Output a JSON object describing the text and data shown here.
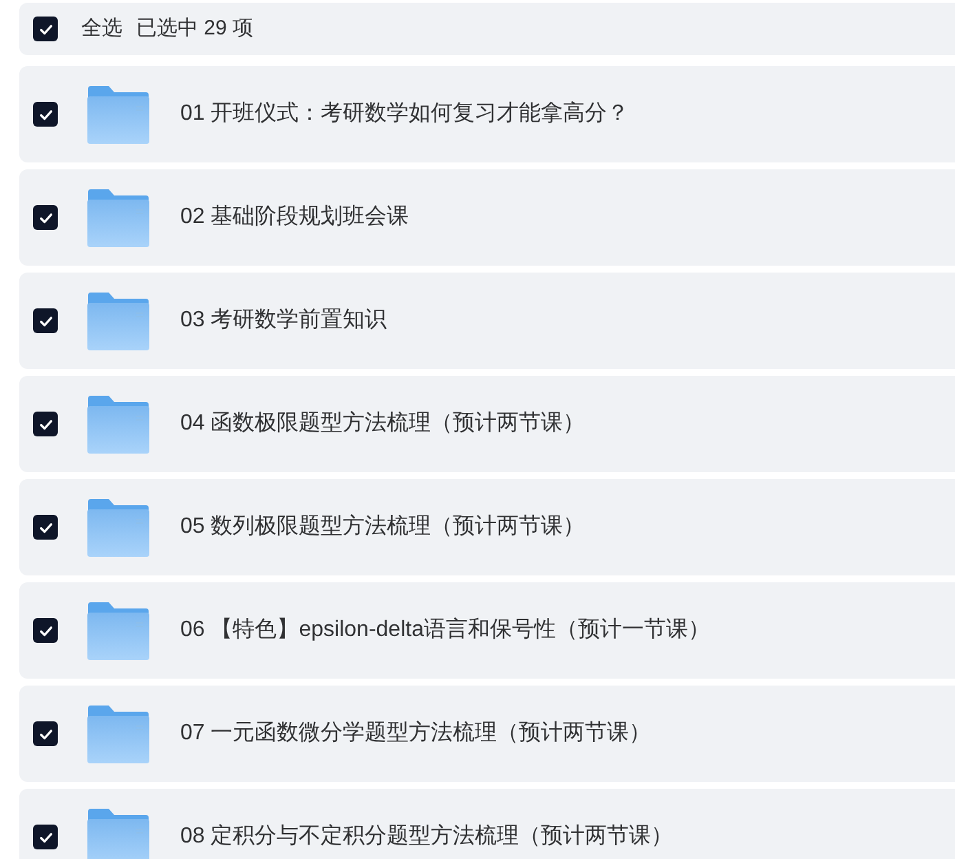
{
  "select_all": {
    "label": "全选",
    "checked": true,
    "summary": "已选中 29 项"
  },
  "items": [
    {
      "title": "01 开班仪式：考研数学如何复习才能拿高分？",
      "checked": true
    },
    {
      "title": "02 基础阶段规划班会课",
      "checked": true
    },
    {
      "title": "03 考研数学前置知识",
      "checked": true
    },
    {
      "title": "04 函数极限题型方法梳理（预计两节课）",
      "checked": true
    },
    {
      "title": "05 数列极限题型方法梳理（预计两节课）",
      "checked": true
    },
    {
      "title": "06 【特色】epsilon-delta语言和保号性（预计一节课）",
      "checked": true
    },
    {
      "title": "07 一元函数微分学题型方法梳理（预计两节课）",
      "checked": true
    },
    {
      "title": "08 定积分与不定积分题型方法梳理（预计两节课）",
      "checked": true
    }
  ]
}
